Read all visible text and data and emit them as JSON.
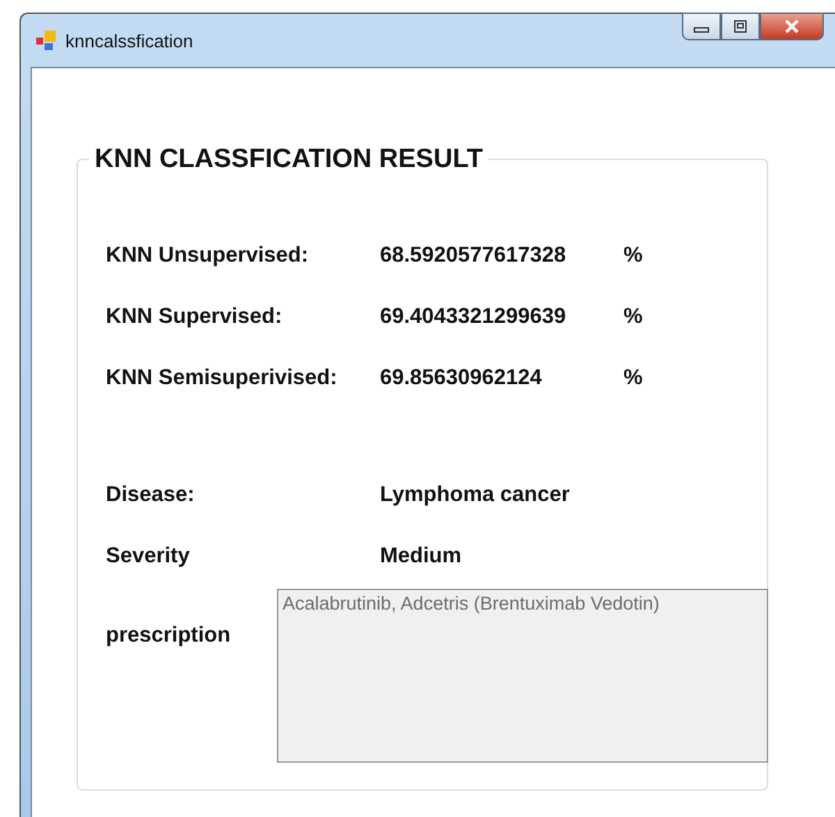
{
  "window": {
    "title": "knncalssfication"
  },
  "group": {
    "title": "KNN CLASSFICATION RESULT"
  },
  "results": [
    {
      "label": "KNN Unsupervised:",
      "value": "68.5920577617328",
      "unit": "%"
    },
    {
      "label": "KNN Supervised:",
      "value": "69.4043321299639",
      "unit": "%"
    },
    {
      "label": "KNN Semisuperivised:",
      "value": "69.85630962124",
      "unit": "%"
    }
  ],
  "details": [
    {
      "label": "Disease:",
      "value": "Lymphoma cancer"
    },
    {
      "label": "Severity",
      "value": "Medium"
    }
  ],
  "prescription": {
    "label": "prescription",
    "value": "Acalabrutinib, Adcetris (Brentuximab Vedotin)",
    "disabled": true
  }
}
